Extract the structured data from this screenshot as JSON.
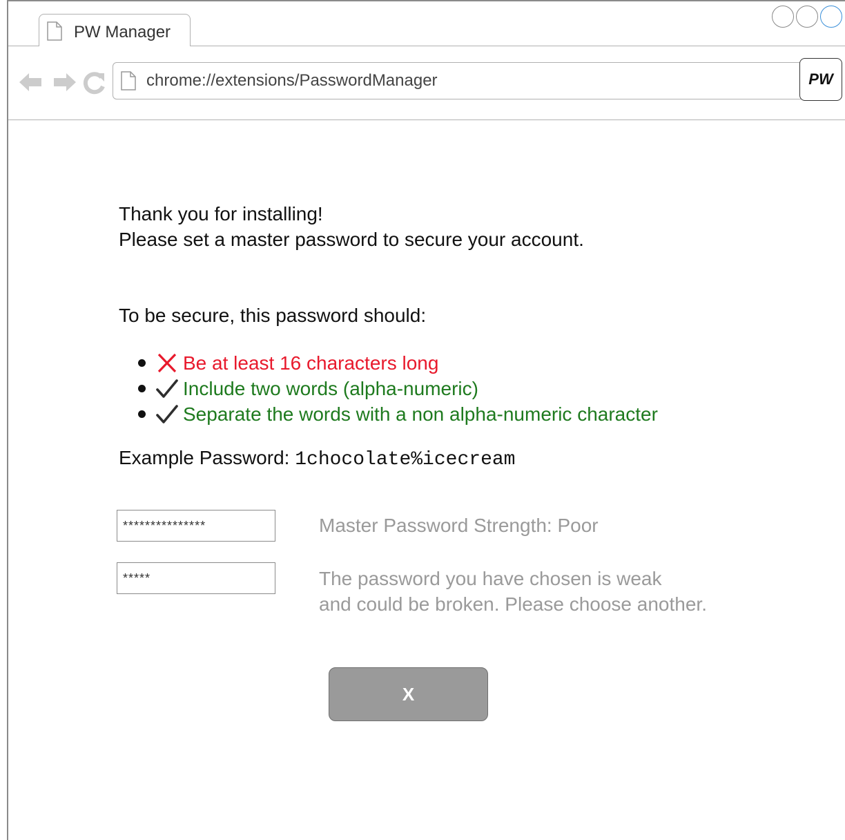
{
  "browser": {
    "tab_title": "PW Manager",
    "address": "chrome://extensions/PasswordManager",
    "extension_label": "PW"
  },
  "content": {
    "intro_line1": "Thank you for installing!",
    "intro_line2": "Please set a master password to secure your account.",
    "requirements_heading": "To be secure, this password should:",
    "requirements": [
      {
        "text": "Be at least 16 characters long",
        "status": "fail",
        "icon": "cross-icon"
      },
      {
        "text": "Include two words (alpha-numeric)",
        "status": "pass",
        "icon": "check-icon"
      },
      {
        "text": "Separate the words with a non alpha-numeric character",
        "status": "pass",
        "icon": "check-icon"
      }
    ],
    "example_label": "Example Password: ",
    "example_value": "1chocolate%icecream",
    "password_value": "***************",
    "confirm_value": "*****",
    "strength_text": "Master Password Strength: Poor",
    "warning_line1": "The password you have chosen is weak",
    "warning_line2": "and could be broken. Please choose another.",
    "close_label": "X"
  },
  "colors": {
    "fail": "#e8192c",
    "pass": "#1e7a1e",
    "muted": "#9a9a9a",
    "button": "#9a9a9a"
  }
}
